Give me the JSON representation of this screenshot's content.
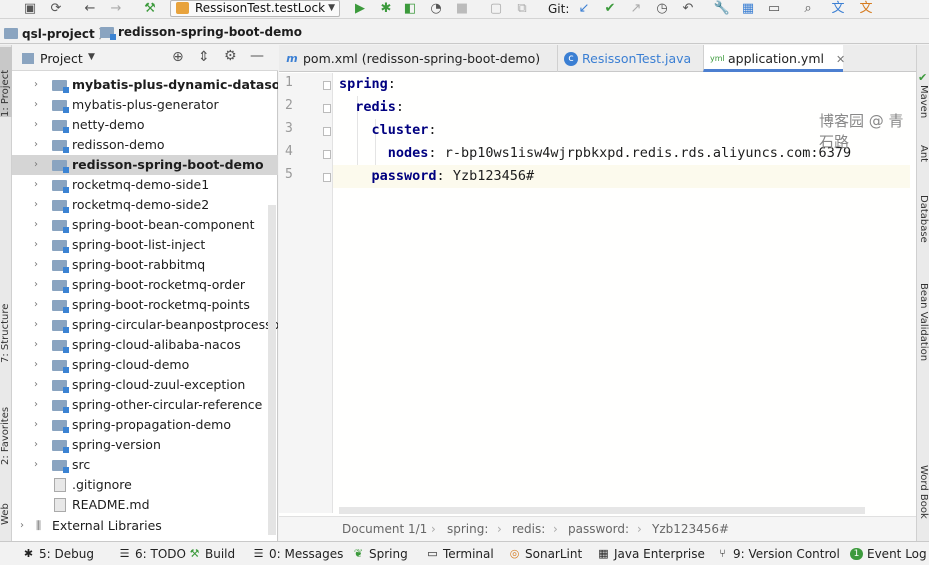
{
  "toolbar": {
    "run_config": "RessisonTest.testLock",
    "git_label": "Git:",
    "icons": [
      "save-icon",
      "sync-icon",
      "back-icon",
      "forward-icon",
      "build-hammer-icon",
      "run-icon",
      "debug-icon",
      "coverage-icon",
      "profile-icon",
      "stop-icon",
      "attach-icon",
      "git-update-icon",
      "git-commit-icon",
      "git-push-icon",
      "history-icon",
      "rollback-icon",
      "settings-icon",
      "project-structure-icon",
      "terminal-icon",
      "search-icon",
      "translate-icon",
      "translate-alt-icon"
    ]
  },
  "breadcrumb": {
    "project": "qsl-project",
    "module": "redisson-spring-boot-demo"
  },
  "left_stripe": {
    "project": "1: Project",
    "structure": "7: Structure",
    "favorites": "2: Favorites",
    "web": "Web"
  },
  "project_panel": {
    "title": "Project",
    "items": [
      {
        "label": "mybatis-plus-dynamic-datasource",
        "type": "module",
        "bold": true
      },
      {
        "label": "mybatis-plus-generator",
        "type": "module"
      },
      {
        "label": "netty-demo",
        "type": "module"
      },
      {
        "label": "redisson-demo",
        "type": "module"
      },
      {
        "label": "redisson-spring-boot-demo",
        "type": "module",
        "bold": true,
        "selected": true
      },
      {
        "label": "rocketmq-demo-side1",
        "type": "module"
      },
      {
        "label": "rocketmq-demo-side2",
        "type": "module"
      },
      {
        "label": "spring-boot-bean-component",
        "type": "module"
      },
      {
        "label": "spring-boot-list-inject",
        "type": "module"
      },
      {
        "label": "spring-boot-rabbitmq",
        "type": "module"
      },
      {
        "label": "spring-boot-rocketmq-order",
        "type": "module"
      },
      {
        "label": "spring-boot-rocketmq-points",
        "type": "module"
      },
      {
        "label": "spring-circular-beanpostprocessor",
        "type": "module"
      },
      {
        "label": "spring-cloud-alibaba-nacos",
        "type": "module"
      },
      {
        "label": "spring-cloud-demo",
        "type": "module"
      },
      {
        "label": "spring-cloud-zuul-exception",
        "type": "module"
      },
      {
        "label": "spring-other-circular-reference",
        "type": "module"
      },
      {
        "label": "spring-propagation-demo",
        "type": "module"
      },
      {
        "label": "spring-version",
        "type": "module"
      },
      {
        "label": "src",
        "type": "module"
      },
      {
        "label": ".gitignore",
        "type": "file"
      },
      {
        "label": "README.md",
        "type": "file"
      }
    ],
    "external_libraries": "External Libraries"
  },
  "tabs": [
    {
      "label": "pom.xml (redisson-spring-boot-demo)",
      "icon": "m",
      "active": false
    },
    {
      "label": "ResissonTest.java",
      "icon": "c",
      "active": false
    },
    {
      "label": "application.yml",
      "icon": "yml",
      "active": true
    }
  ],
  "editor": {
    "lines": [
      {
        "n": "1",
        "key": "spring",
        "value": ""
      },
      {
        "n": "2",
        "key": "redis",
        "value": ""
      },
      {
        "n": "3",
        "key": "cluster",
        "value": ""
      },
      {
        "n": "4",
        "key": "nodes",
        "value": "r-bp10ws1isw4wjrpbkxpd.redis.rds.aliyuncs.com:6379"
      },
      {
        "n": "5",
        "key": "password",
        "value": "Yzb123456#"
      }
    ],
    "watermark": "博客园 @ 青石路",
    "breadcrumb": [
      "Document 1/1",
      "spring:",
      "redis:",
      "password:",
      "Yzb123456#"
    ]
  },
  "right_stripe": [
    "Maven",
    "Ant",
    "Database",
    "Bean Validation",
    "Word Book"
  ],
  "statusbar": {
    "items": [
      {
        "label": "5: Debug",
        "icon": "bug-icon"
      },
      {
        "label": "6: TODO",
        "icon": "todo-icon"
      },
      {
        "label": "Build",
        "icon": "build-icon"
      },
      {
        "label": "0: Messages",
        "icon": "messages-icon"
      },
      {
        "label": "Spring",
        "icon": "spring-icon"
      },
      {
        "label": "Terminal",
        "icon": "terminal-icon"
      },
      {
        "label": "SonarLint",
        "icon": "sonarlint-icon"
      },
      {
        "label": "Java Enterprise",
        "icon": "java-enterprise-icon"
      },
      {
        "label": "9: Version Control",
        "icon": "version-control-icon"
      },
      {
        "label": "Event Log",
        "icon": "event-log-icon"
      }
    ]
  },
  "colors": {
    "yaml_key": "#000080",
    "selection": "#d5d5d5",
    "active_tab_underline": "#4c7fd0",
    "run_green": "#3c9a3c"
  }
}
